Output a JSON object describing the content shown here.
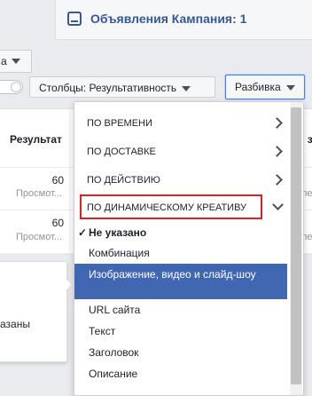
{
  "header": {
    "tab_title": "Объявления Кампания: 1",
    "left_stub_label": "а"
  },
  "toolbar": {
    "columns_label": "Столбцы: Результативность",
    "breakdown_label": "Разбивка"
  },
  "table": {
    "headers": [
      "Результат",
      "и з"
    ],
    "rows": [
      {
        "value": "60",
        "sub": "Просмот..."
      },
      {
        "value": "60",
        "sub": "Просмот..."
      }
    ],
    "right_cells": [
      "ле",
      "ле"
    ]
  },
  "popover": {
    "text": "азаны"
  },
  "menu": {
    "sections": [
      {
        "label": "По времени"
      },
      {
        "label": "По доставке"
      },
      {
        "label": "По действию"
      },
      {
        "label": "По динамическому креативу"
      }
    ],
    "options": [
      {
        "label": "Не указано",
        "selected": true
      },
      {
        "label": "Комбинация"
      },
      {
        "label": "Изображение, видео и слайд-шоу",
        "active": true
      },
      {
        "label": "URL сайта"
      },
      {
        "label": "Текст"
      },
      {
        "label": "Заголовок"
      },
      {
        "label": "Описание"
      }
    ]
  },
  "colors": {
    "brand_blue": "#4267b2",
    "link_blue": "#365899",
    "highlight_red": "#e02020"
  }
}
